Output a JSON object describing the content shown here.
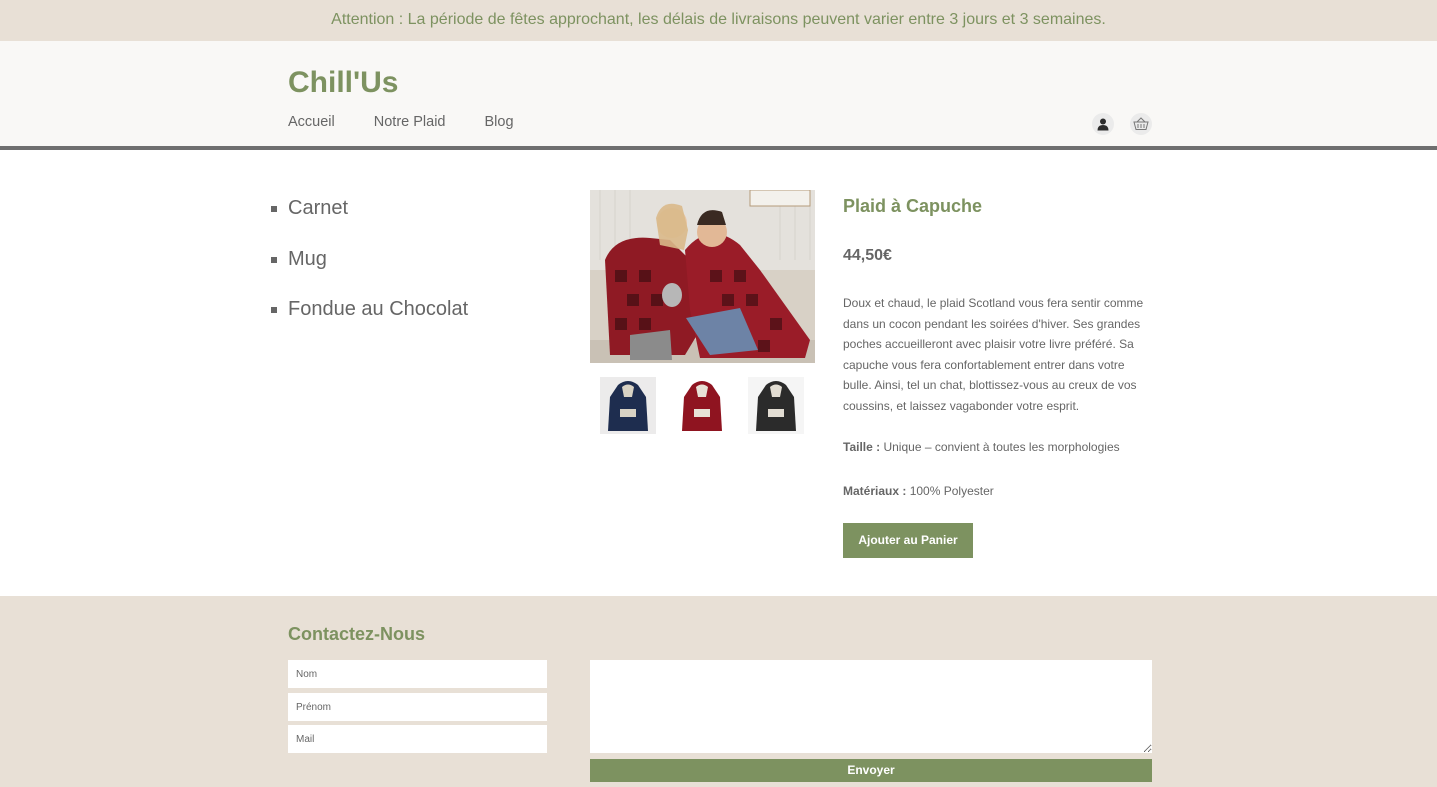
{
  "announcement": "Attention : La période de fêtes approchant, les délais de livraisons peuvent varier entre 3 jours et 3 semaines.",
  "header": {
    "logo": "Chill'Us",
    "nav": [
      "Accueil",
      "Notre Plaid",
      "Blog"
    ],
    "icons": [
      "user-icon",
      "cart-icon"
    ]
  },
  "sidebar": {
    "items": [
      "Carnet",
      "Mug",
      "Fondue au Chocolat"
    ]
  },
  "product": {
    "title": "Plaid à Capuche",
    "price": "44,50€",
    "description": "Doux et chaud, le plaid Scotland vous fera sentir comme dans un cocon pendant les soirées d'hiver. Ses grandes poches accueilleront avec plaisir votre livre préféré. Sa capuche vous fera confortablement entrer dans votre bulle. Ainsi, tel un chat, blottissez-vous au creux de vos coussins, et laissez vagabonder votre esprit.",
    "size_label": "Taille :",
    "size_value": "Unique – convient à toutes les morphologies",
    "material_label": "Matériaux :",
    "material_value": "100% Polyester",
    "add_button": "Ajouter au Panier",
    "thumbnail_colors": [
      "#1e2d4f",
      "#8f1420",
      "#2b2b2b"
    ]
  },
  "contact": {
    "title": "Contactez-Nous",
    "fields": [
      "Nom",
      "Prénom",
      "Mail"
    ],
    "send_button": "Envoyer"
  },
  "colors": {
    "accent": "#7d9260",
    "sand": "#e8e0d6",
    "text": "#666666"
  }
}
